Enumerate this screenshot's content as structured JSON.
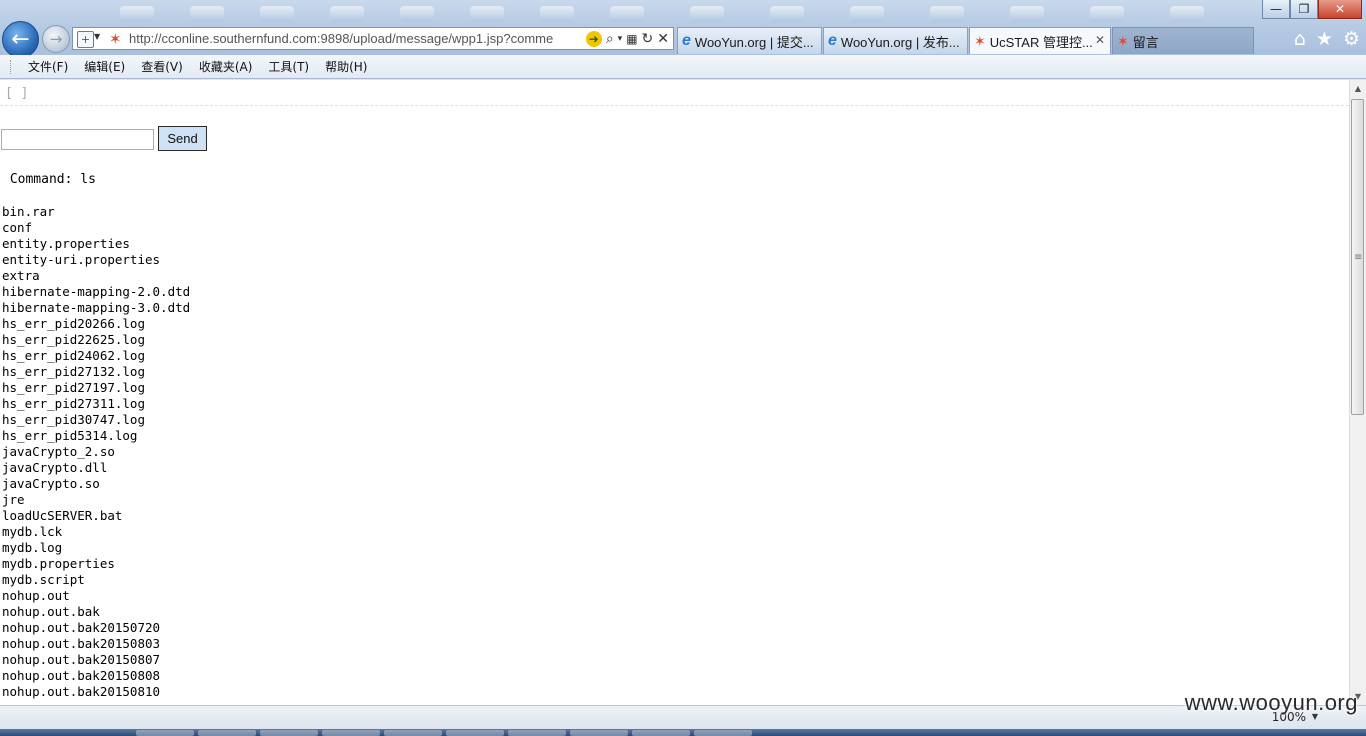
{
  "window": {
    "minimize_label": "—",
    "restore_label": "❐",
    "close_label": "✕"
  },
  "nav": {
    "back_icon": "←",
    "forward_icon": "→"
  },
  "address": {
    "url": "http://cconline.southernfund.com:9898/upload/message/wpp1.jsp?comme",
    "compat_icon": "+",
    "dropdown_icon": "▼",
    "site_icon": "✶",
    "go_icon": "➜",
    "search_icon": "⌕",
    "search_dropdown": "▾",
    "compat_view_icon": "▦",
    "refresh_icon": "↻",
    "stop_icon": "✕"
  },
  "tabs": [
    {
      "label": "WooYun.org | 提交...",
      "icon": "ie-icon"
    },
    {
      "label": "WooYun.org | 发布...",
      "icon": "ie-icon"
    },
    {
      "label": "UcSTAR 管理控...",
      "icon": "ucstar-icon",
      "close": "✕"
    },
    {
      "label": "留言",
      "icon": "ucstar-icon"
    }
  ],
  "toolbar_right": {
    "home_icon": "⌂",
    "favorites_icon": "★",
    "tools_icon": "⚙"
  },
  "menu": [
    "文件(F)",
    "编辑(E)",
    "查看(V)",
    "收藏夹(A)",
    "工具(T)",
    "帮助(H)"
  ],
  "content": {
    "brackets": "[ ]",
    "input_value": "",
    "send_label": "Send",
    "command_line": " Command: ls",
    "files": [
      "bin.rar",
      "conf",
      "entity.properties",
      "entity-uri.properties",
      "extra",
      "hibernate-mapping-2.0.dtd",
      "hibernate-mapping-3.0.dtd",
      "hs_err_pid20266.log",
      "hs_err_pid22625.log",
      "hs_err_pid24062.log",
      "hs_err_pid27132.log",
      "hs_err_pid27197.log",
      "hs_err_pid27311.log",
      "hs_err_pid30747.log",
      "hs_err_pid5314.log",
      "javaCrypto_2.so",
      "javaCrypto.dll",
      "javaCrypto.so",
      "jre",
      "loadUcSERVER.bat",
      "mydb.lck",
      "mydb.log",
      "mydb.properties",
      "mydb.script",
      "nohup.out",
      "nohup.out.bak",
      "nohup.out.bak20150720",
      "nohup.out.bak20150803",
      "nohup.out.bak20150807",
      "nohup.out.bak20150808",
      "nohup.out.bak20150810"
    ]
  },
  "status": {
    "zoom": "100%",
    "zoom_dropdown": "▼"
  },
  "watermark": "www.wooyun.org"
}
